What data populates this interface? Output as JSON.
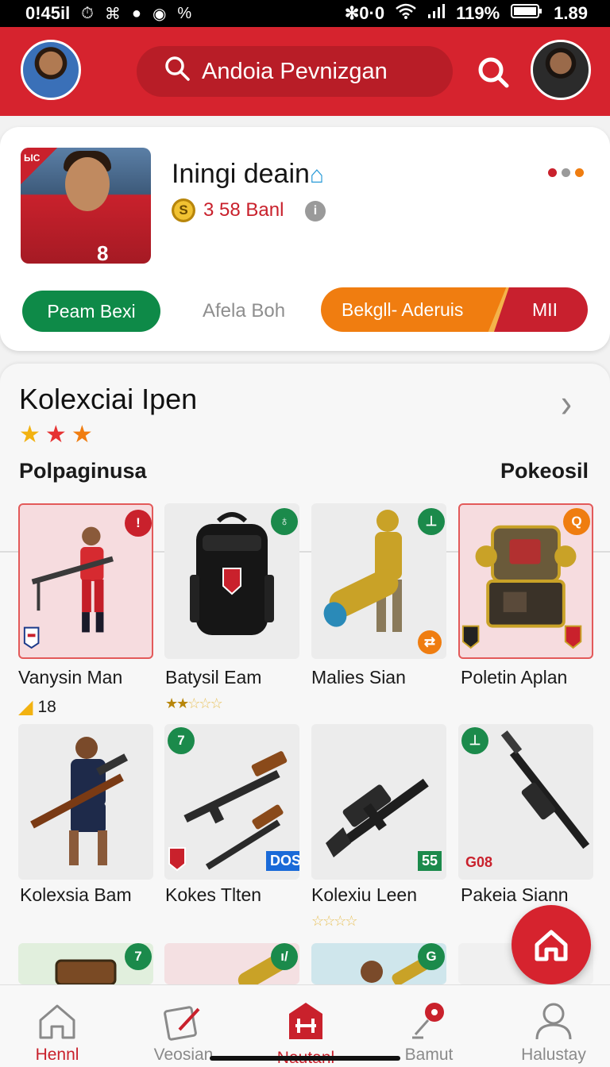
{
  "status_bar": {
    "time": "0!45il",
    "left_icons": [
      "timer-icon",
      "nfc-icon",
      "circle-icon",
      "compass-icon"
    ],
    "left_extra": "%",
    "right_text": "✻0·0",
    "battery_percent": "119%",
    "right_time": "1.89"
  },
  "header": {
    "search_text": "Andoia Pevnizgan",
    "brand_color": "#d6232e"
  },
  "profile": {
    "name": "Iningi deain",
    "coins_text": "3 58 Banl",
    "coin_symbol": "S",
    "photo_corner_text": "ЫС",
    "photo_number": "8",
    "green_button": "Peam Bexi",
    "grey_link": "Afela Boh",
    "orange_button": "Bekgll- Aderuis",
    "red_button": "MII",
    "dot_colors": [
      "#c9212c",
      "#9a9a9a",
      "#ef7d10"
    ]
  },
  "collection": {
    "title": "Kolexciai Ipen",
    "stars": [
      "#f2b211",
      "#e63232",
      "#f07d10"
    ],
    "sub_left": "Polpaginusa",
    "sub_right": "Pokeosil",
    "items": [
      {
        "name": "Vanysin Man",
        "extra": "18",
        "badge": "!",
        "badge_color": "red",
        "art": "soldier-figure"
      },
      {
        "name": "Batysil Eam",
        "stars_filled": 1.5,
        "badge": "♁",
        "badge_color": "green",
        "art": "backpack"
      },
      {
        "name": "Malies Sian",
        "badge": "⊥",
        "badge_color": "green",
        "art": "armored-trooper"
      },
      {
        "name": "Poletin Aplan",
        "badge": "Q",
        "badge_color": "orange",
        "art": "gold-robot"
      },
      {
        "name": "Kolexsia Bam",
        "badge": "♁",
        "badge_color": "green",
        "art": "gunner-figure"
      },
      {
        "name": "Kokes Tlten",
        "badge": "7",
        "badge_color": "green",
        "tag": "DOS",
        "art": "rifles"
      },
      {
        "name": "Kolexiu Leen",
        "stars_filled": 0,
        "tag": "55",
        "art": "assault-rifle"
      },
      {
        "name": "Pakeia Siann",
        "badge": "⊥",
        "badge_color": "green",
        "tag": "G08",
        "art": "sniper-rifle"
      },
      {
        "badge": "7",
        "badge_color": "green",
        "art": "treasure-chest"
      },
      {
        "badge": "ı/",
        "badge_color": "green",
        "art": "gold-cannon"
      },
      {
        "badge": "G",
        "badge_color": "green",
        "art": "player-with-launcher"
      },
      {
        "art": "blank"
      }
    ]
  },
  "bottom_nav": {
    "items": [
      {
        "label": "Hennl",
        "icon": "home-icon",
        "active": true
      },
      {
        "label": "Veosian",
        "icon": "edit-icon",
        "active": false
      },
      {
        "label": "Nautanl",
        "icon": "shop-icon",
        "active": true
      },
      {
        "label": "Bamut",
        "icon": "pin-icon",
        "active": false
      },
      {
        "label": "Halustay",
        "icon": "profile-icon",
        "active": false
      }
    ]
  }
}
